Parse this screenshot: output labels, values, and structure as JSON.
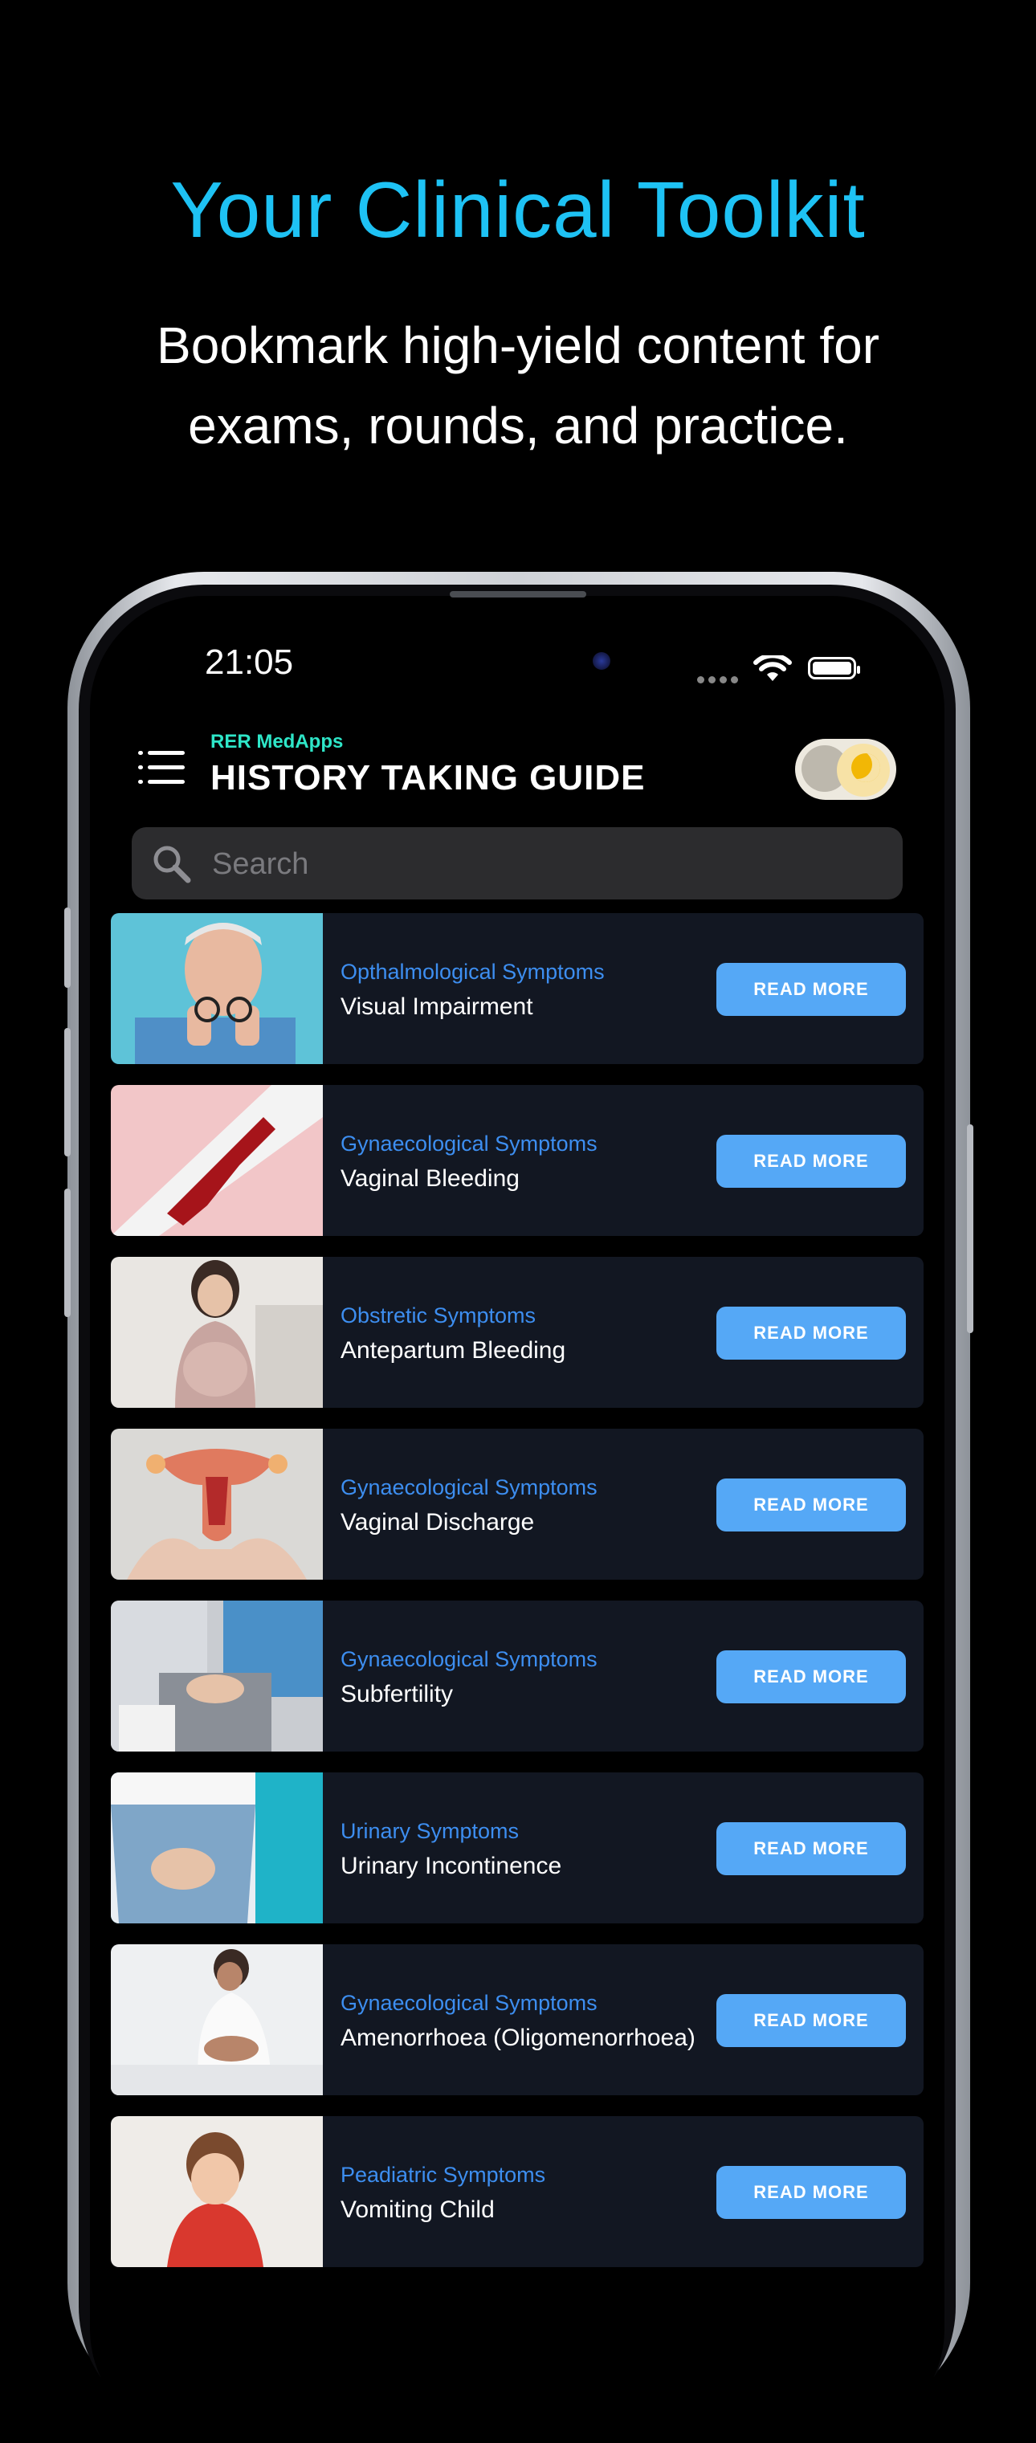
{
  "promo": {
    "headline": "Your Clinical Toolkit",
    "subline": "Bookmark high-yield content for exams, rounds, and practice."
  },
  "status_bar": {
    "time": "21:05"
  },
  "header": {
    "brand": "RER MedApps",
    "title": "HISTORY TAKING GUIDE",
    "theme_toggle": "dark-mode-toggle"
  },
  "search": {
    "placeholder": "Search",
    "value": ""
  },
  "colors": {
    "background": "#000000",
    "headline": "#1ec2f4",
    "card": "#121722",
    "category": "#3d8ef0",
    "button": "#55a8f6"
  },
  "cards": [
    {
      "category": "Opthalmological Symptoms",
      "title": "Visual Impairment",
      "button": "READ MORE",
      "image": "man-holding-glasses"
    },
    {
      "category": "Gynaecological Symptoms",
      "title": "Vaginal Bleeding",
      "button": "READ MORE",
      "image": "red-stain-on-pad"
    },
    {
      "category": "Obstretic Symptoms",
      "title": "Antepartum Bleeding",
      "button": "READ MORE",
      "image": "pregnant-woman"
    },
    {
      "category": "Gynaecological Symptoms",
      "title": "Vaginal Discharge",
      "button": "READ MORE",
      "image": "uterus-model-in-hands"
    },
    {
      "category": "Gynaecological Symptoms",
      "title": "Subfertility",
      "button": "READ MORE",
      "image": "couple-holding-hands"
    },
    {
      "category": "Urinary Symptoms",
      "title": "Urinary Incontinence",
      "button": "READ MORE",
      "image": "hands-on-jeans"
    },
    {
      "category": "Gynaecological Symptoms",
      "title": "Amenorrhoea (Oligomenorrhoea)",
      "button": "READ MORE",
      "image": "woman-in-pain-on-bed"
    },
    {
      "category": "Peadiatric Symptoms",
      "title": "Vomiting Child",
      "button": "READ MORE",
      "image": "child-covering-mouth"
    }
  ]
}
